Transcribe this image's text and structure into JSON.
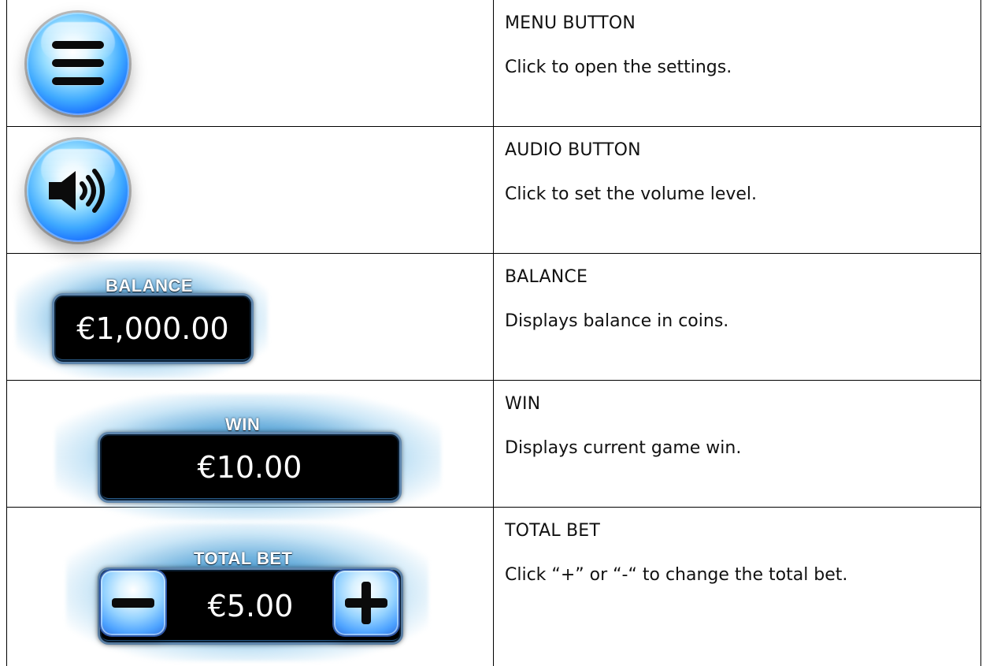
{
  "rows": [
    {
      "title": "MENU BUTTON",
      "description": "Click to open the settings."
    },
    {
      "title": "AUDIO BUTTON",
      "description": "Click to set the volume level."
    },
    {
      "title": "BALANCE",
      "description": "Displays balance in coins."
    },
    {
      "title": "WIN",
      "description": "Displays current game win."
    },
    {
      "title": "TOTAL BET",
      "description": "Click “+” or “-“ to change the total bet."
    }
  ],
  "widgets": {
    "balance": {
      "label": "BALANCE",
      "value": "€1,000.00"
    },
    "win": {
      "label": "WIN",
      "value": "€10.00"
    },
    "total_bet": {
      "label": "TOTAL BET",
      "value": "€5.00"
    }
  },
  "icons": {
    "menu": "hamburger-menu-icon",
    "audio": "speaker-icon",
    "minus": "minus-icon",
    "plus": "plus-icon"
  },
  "colors": {
    "button_blue": "#3ea9ff",
    "panel_glow": "#288cd2",
    "value_box": "#000000"
  }
}
